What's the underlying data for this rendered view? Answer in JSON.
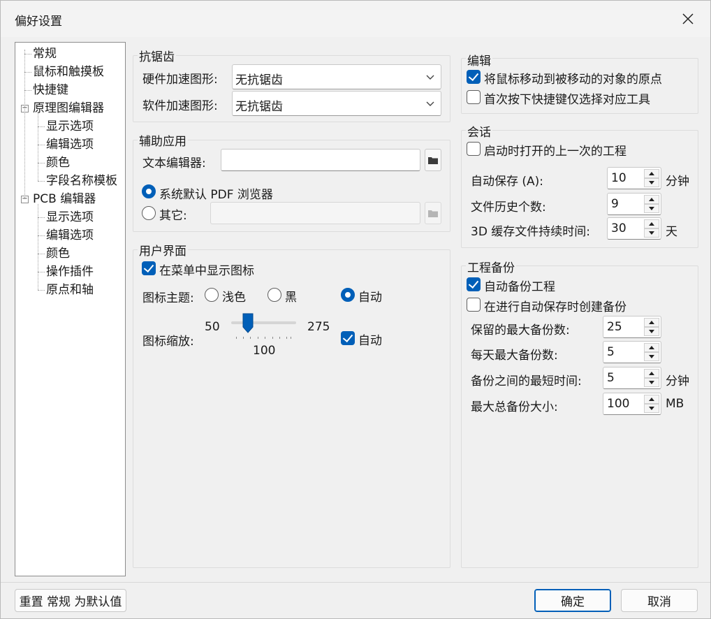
{
  "window": {
    "title": "偏好设置"
  },
  "tree": [
    {
      "label": "常规",
      "level": 0
    },
    {
      "label": "鼠标和触摸板",
      "level": 0
    },
    {
      "label": "快捷键",
      "level": 0
    },
    {
      "label": "原理图编辑器",
      "level": 0,
      "expander": "−"
    },
    {
      "label": "显示选项",
      "level": 1
    },
    {
      "label": "编辑选项",
      "level": 1
    },
    {
      "label": "颜色",
      "level": 1
    },
    {
      "label": "字段名称模板",
      "level": 1
    },
    {
      "label": "PCB 编辑器",
      "level": 0,
      "expander": "−"
    },
    {
      "label": "显示选项",
      "level": 1
    },
    {
      "label": "编辑选项",
      "level": 1
    },
    {
      "label": "颜色",
      "level": 1
    },
    {
      "label": "操作插件",
      "level": 1
    },
    {
      "label": "原点和轴",
      "level": 1
    }
  ],
  "antialias": {
    "title": "抗锯齿",
    "hw_label": "硬件加速图形:",
    "hw_value": "无抗锯齿",
    "sw_label": "软件加速图形:",
    "sw_value": "无抗锯齿"
  },
  "helper": {
    "title": "辅助应用",
    "text_editor_label": "文本编辑器:",
    "text_editor_value": "",
    "pdf_default_label": "系统默认 PDF 浏览器",
    "pdf_default_checked": true,
    "pdf_other_label": "其它:",
    "pdf_other_value": ""
  },
  "ui": {
    "title": "用户界面",
    "show_icons_label": "在菜单中显示图标",
    "show_icons_checked": true,
    "theme_label": "图标主题:",
    "theme_options": [
      "浅色",
      "黑",
      "自动"
    ],
    "theme_selected": "自动",
    "scale_label": "图标缩放:",
    "scale_min": "50",
    "scale_max": "275",
    "scale_value": "100",
    "scale_auto_label": "自动",
    "scale_auto_checked": true
  },
  "editing": {
    "title": "编辑",
    "warp_label": "将鼠标移动到被移动的对象的原点",
    "warp_checked": true,
    "first_hotkey_label": "首次按下快捷键仅选择对应工具",
    "first_hotkey_checked": false
  },
  "session": {
    "title": "会话",
    "reopen_label": "启动时打开的上一次的工程",
    "reopen_checked": false,
    "autosave_label": "自动保存 (A):",
    "autosave_value": "10",
    "autosave_unit": "分钟",
    "history_label": "文件历史个数:",
    "history_value": "9",
    "cache_label": "3D 缓存文件持续时间:",
    "cache_value": "30",
    "cache_unit": "天"
  },
  "backup": {
    "title": "工程备份",
    "auto_backup_label": "自动备份工程",
    "auto_backup_checked": true,
    "on_autosave_label": "在进行自动保存时创建备份",
    "on_autosave_checked": false,
    "max_label": "保留的最大备份数:",
    "max_value": "25",
    "daily_label": "每天最大备份数:",
    "daily_value": "5",
    "interval_label": "备份之间的最短时间:",
    "interval_value": "5",
    "interval_unit": "分钟",
    "size_label": "最大总备份大小:",
    "size_value": "100",
    "size_unit": "MB"
  },
  "footer": {
    "reset_label": "重置 常规 为默认值",
    "ok_label": "确定",
    "cancel_label": "取消"
  },
  "colors": {
    "accent": "#005fb8"
  }
}
